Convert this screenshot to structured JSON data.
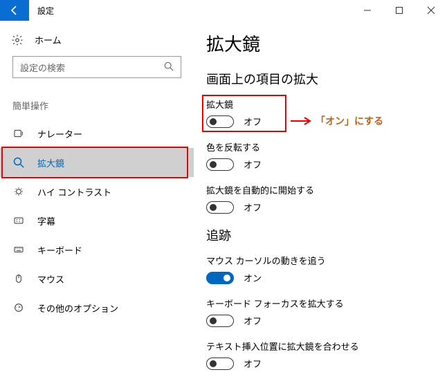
{
  "window": {
    "title": "設定"
  },
  "sidebar": {
    "home": "ホーム",
    "search_placeholder": "設定の検索",
    "section": "簡単操作",
    "items": [
      {
        "label": "ナレーター"
      },
      {
        "label": "拡大鏡"
      },
      {
        "label": "ハイ コントラスト"
      },
      {
        "label": "字幕"
      },
      {
        "label": "キーボード"
      },
      {
        "label": "マウス"
      },
      {
        "label": "その他のオプション"
      }
    ]
  },
  "main": {
    "title": "拡大鏡",
    "section1": "画面上の項目の拡大",
    "settings1": [
      {
        "label": "拡大鏡",
        "state": "オフ",
        "on": false
      },
      {
        "label": "色を反転する",
        "state": "オフ",
        "on": false
      },
      {
        "label": "拡大鏡を自動的に開始する",
        "state": "オフ",
        "on": false
      }
    ],
    "section2": "追跡",
    "settings2": [
      {
        "label": "マウス カーソルの動きを追う",
        "state": "オン",
        "on": true
      },
      {
        "label": "キーボード フォーカスを拡大する",
        "state": "オフ",
        "on": false
      },
      {
        "label": "テキスト挿入位置に拡大鏡を合わせる",
        "state": "オフ",
        "on": false
      }
    ]
  },
  "annotation": {
    "text": "「オン」にする"
  }
}
